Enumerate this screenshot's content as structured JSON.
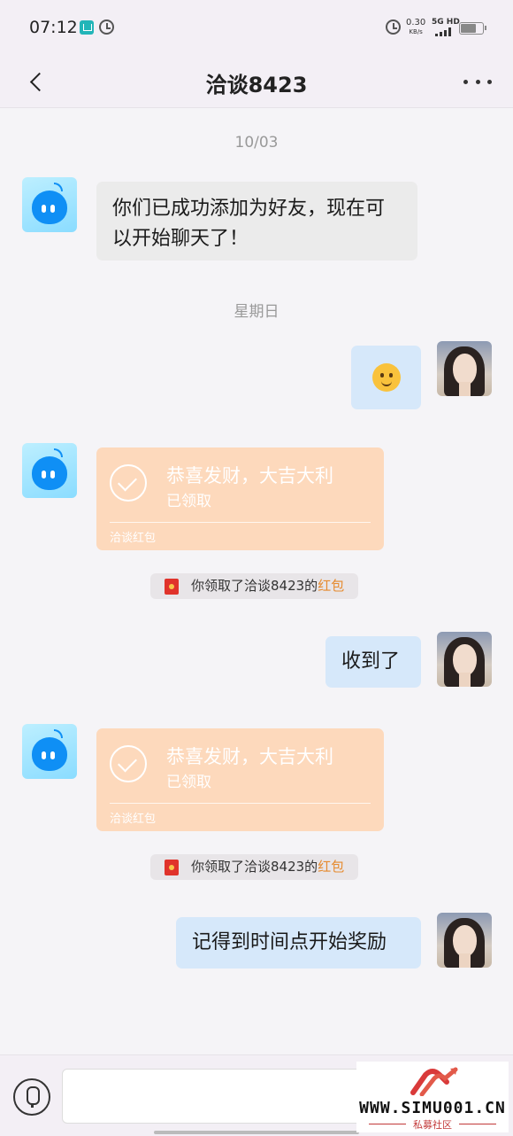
{
  "status_bar": {
    "time": "07:12",
    "speed_value": "0.30",
    "speed_unit": "KB/s",
    "network": "5G HD"
  },
  "header": {
    "title": "洽谈8423"
  },
  "messages": {
    "date_1": "10/03",
    "system_greeting": "你们已成功添加为好友，现在可以开始聊天了！",
    "date_2": "星期日",
    "red_packets": [
      {
        "title": "恭喜发财，大吉大利",
        "status": "已领取",
        "footer": "洽谈红包"
      },
      {
        "title": "恭喜发财，大吉大利",
        "status": "已领取",
        "footer": "洽谈红包"
      }
    ],
    "notices": [
      {
        "text": "你领取了洽谈8423的",
        "highlight": "红包"
      },
      {
        "text": "你领取了洽谈8423的",
        "highlight": "红包"
      }
    ],
    "reply_1": "收到了",
    "reply_2": "记得到时间点开始奖励"
  },
  "watermark": {
    "site": "WWW.SIMU001.CN",
    "name": "私募社区"
  },
  "icons": {
    "back": "back-chevron-icon",
    "more": "more-dots-icon",
    "voice": "microphone-icon",
    "alarm": "alarm-clock-icon",
    "app": "home-app-icon",
    "battery": "battery-icon",
    "signal": "signal-bars-icon",
    "red_packet": "red-envelope-icon",
    "check": "check-circle-icon"
  },
  "colors": {
    "accent_highlight": "#e68a2e",
    "red_packet_bg": "#fdd9bc",
    "my_bubble": "#d6e8fa",
    "their_bubble": "#ebebeb"
  }
}
